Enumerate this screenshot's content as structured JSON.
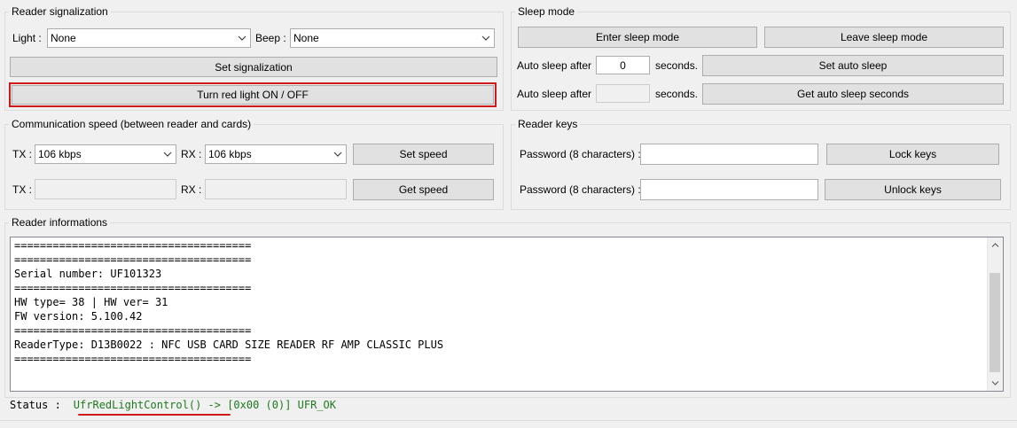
{
  "reader_signalization": {
    "title": "Reader signalization",
    "light_label": "Light :",
    "light_value": "None",
    "beep_label": "Beep :",
    "beep_value": "None",
    "set_signalization": "Set signalization",
    "turn_red_light": "Turn red light ON / OFF"
  },
  "sleep_mode": {
    "title": "Sleep mode",
    "enter_sleep": "Enter sleep mode",
    "leave_sleep": "Leave sleep mode",
    "auto_sleep_label": "Auto sleep after",
    "auto_sleep_value": "0",
    "seconds": "seconds.",
    "set_auto_sleep": "Set auto sleep",
    "get_auto_sleep": "Get auto sleep seconds"
  },
  "comm_speed": {
    "title": "Communication speed (between reader and cards)",
    "tx_label": "TX :",
    "rx_label": "RX :",
    "tx_value": "106 kbps",
    "rx_value": "106 kbps",
    "set_speed": "Set speed",
    "get_speed": "Get speed"
  },
  "reader_keys": {
    "title": "Reader keys",
    "password_label": "Password (8 characters) :",
    "lock_keys": "Lock keys",
    "unlock_keys": "Unlock keys"
  },
  "reader_info": {
    "title": "Reader informations",
    "text": "=====================================\n=====================================\nSerial number: UF101323\n=====================================\nHW type= 38 | HW ver= 31\nFW version: 5.100.42\n=====================================\nReaderType: D13B0022 : NFC USB CARD SIZE READER RF AMP CLASSIC PLUS\n====================================="
  },
  "status": {
    "label": "Status :",
    "value": "UfrRedLightControl() -> [0x00 (0)] UFR_OK"
  },
  "colors": {
    "highlight": "#d01a1a",
    "status_text": "#1f7a1f"
  }
}
